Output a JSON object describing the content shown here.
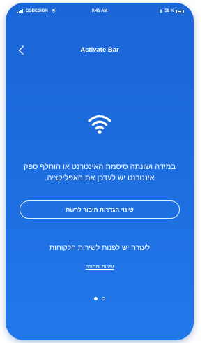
{
  "status_bar": {
    "carrier": "OSDESIGN",
    "time": "9:41 AM",
    "battery": "58 %"
  },
  "header": {
    "title": "Activate Bar",
    "back_icon": "chevron-left-icon"
  },
  "main": {
    "icon": "wifi-icon",
    "message": "במידה ושונתה סיסמת האינטרנט או הוחלף ספק אינטרנט יש לעדכן את האפליקציה.",
    "network_button_label": "שינוי הגדרות חיבור לרשת",
    "help_text": "לעזרה יש לפנות לשירות הלקוחות",
    "service_link": "שירות ותמיכה"
  },
  "pager": {
    "total": 2,
    "current": 1
  },
  "colors": {
    "background": "#1e6fe0",
    "foreground": "#ffffff"
  }
}
